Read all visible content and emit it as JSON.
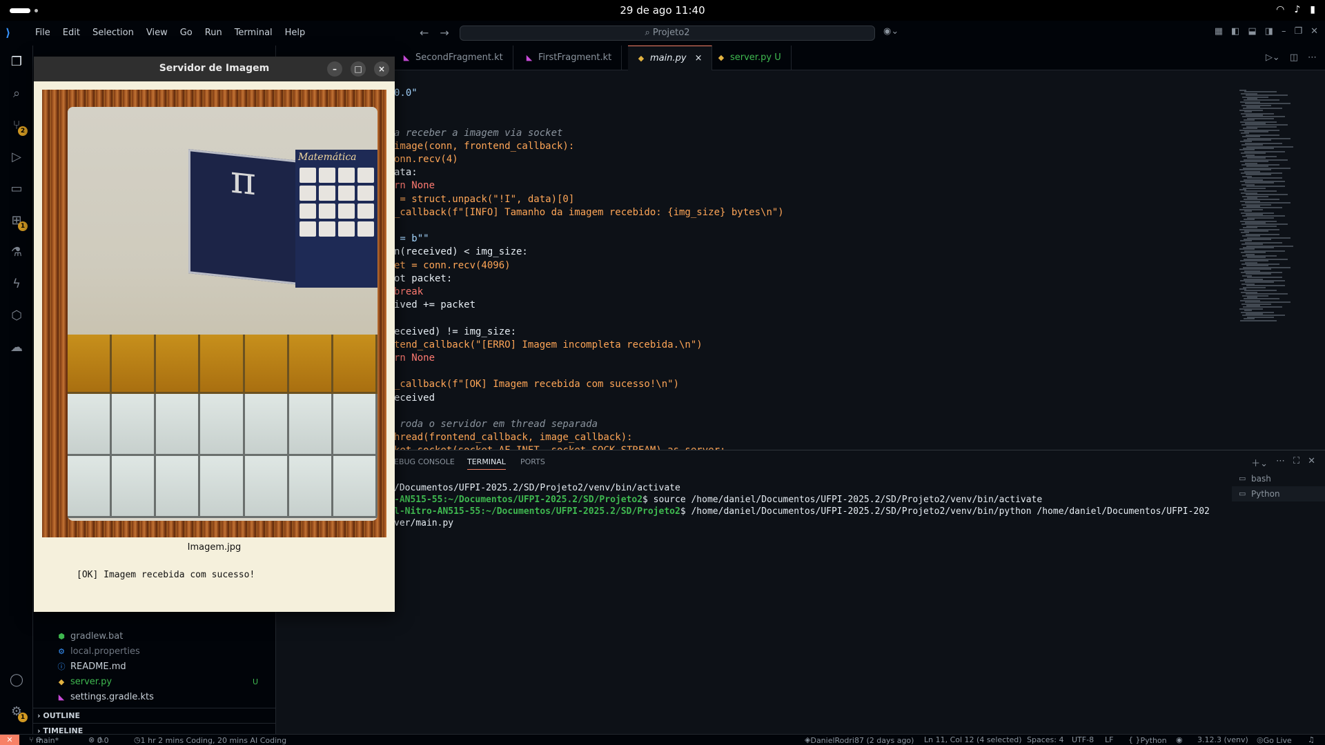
{
  "topbar": {
    "clock": "29 de ago  11:40",
    "system_icons": [
      "wifi-icon",
      "volume-icon",
      "battery-icon"
    ]
  },
  "vscode": {
    "menu": [
      "File",
      "Edit",
      "Selection",
      "View",
      "Go",
      "Run",
      "Terminal",
      "Help"
    ],
    "search_placeholder": "Projeto2",
    "tabs": [
      {
        "label": "SecondFragment.kt",
        "icon": "kotlin-icon"
      },
      {
        "label": "FirstFragment.kt",
        "icon": "kotlin-icon"
      },
      {
        "label": "main.py",
        "icon": "python-icon",
        "active": true,
        "close": "×"
      },
      {
        "label": "server.py",
        "icon": "python-icon",
        "status": "U"
      }
    ],
    "explorer_files": [
      {
        "name": "gradlew.bat",
        "icon": "gradle-icon",
        "color": "#8b949e"
      },
      {
        "name": "local.properties",
        "icon": "gear-icon",
        "color": "#6e7681"
      },
      {
        "name": "README.md",
        "icon": "info-icon",
        "color": "#c9d1d9"
      },
      {
        "name": "server.py",
        "icon": "python-icon",
        "color": "#3fb950",
        "git": "U"
      },
      {
        "name": "settings.gradle.kts",
        "icon": "kotlin-icon",
        "color": "#c9d1d9"
      }
    ],
    "sections": [
      "OUTLINE",
      "TIMELINE"
    ],
    "code_lines": [
      "0.0\"",
      "",
      "",
      "a receber a imagem via socket",
      "image(conn, frontend_callback):",
      "onn.recv(4)",
      "ata:",
      "rn None",
      " = struct.unpack(\"!I\", data)[0]",
      "_callback(f\"[INFO] Tamanho da imagem recebido: {img_size} bytes\\n\")",
      "",
      " = b\"\"",
      "n(received) < img_size:",
      "et = conn.recv(4096)",
      "ot packet:",
      "break",
      "ived += packet",
      "",
      "eceived) != img_size:",
      "tend_callback(\"[ERRO] Imagem incompleta recebida.\\n\")",
      "rn None",
      "",
      "_callback(f\"[OK] Imagem recebida com sucesso!\\n\")",
      "eceived",
      "",
      " roda o servidor em thread separada",
      "hread(frontend_callback, image_callback):",
      "ket.socket(socket.AF_INET, socket.SOCK_STREAM) as server:"
    ],
    "panel_tabs": [
      "EBUG CONSOLE",
      "TERMINAL",
      "PORTS"
    ],
    "terminal_lines": [
      {
        "prompt": "",
        "text": "/Documentos/UFPI-2025.2/SD/Projeto2/venv/bin/activate"
      },
      {
        "prompt": "-AN515-55:~/Documentos/UFPI-2025.2/SD/Projeto2",
        "text": "$ source /home/daniel/Documentos/UFPI-2025.2/SD/Projeto2/venv/bin/activate"
      },
      {
        "prompt": "l-Nitro-AN515-55:~/Documentos/UFPI-2025.2/SD/Projeto2",
        "text": "$ /home/daniel/Documentos/UFPI-2025.2/SD/Projeto2/venv/bin/python /home/daniel/Documentos/UFPI-202"
      },
      {
        "prompt": "",
        "text": "ver/main.py"
      }
    ],
    "terminal_list": [
      "bash",
      "Python"
    ],
    "status": {
      "branch": "main*",
      "problems": "0",
      "warnings": "0",
      "time": "1 hr 2 mins Coding, 20 mins AI Coding",
      "author": "DanielRodri87 (2 days ago)",
      "cursor": "Ln 11, Col 12 (4 selected)",
      "spaces": "Spaces: 4",
      "encoding": "UTF-8",
      "eol": "LF",
      "language": "Python",
      "interpreter": "3.12.3 (venv)",
      "golive": "Go Live"
    }
  },
  "viewer": {
    "title": "Servidor de Imagem",
    "caption": "Imagem.jpg",
    "status": "[OK] Imagem recebida com sucesso!",
    "poster_title": "Matemática",
    "plaque_symbol": "π",
    "controls": [
      "–",
      "□",
      "×"
    ]
  }
}
